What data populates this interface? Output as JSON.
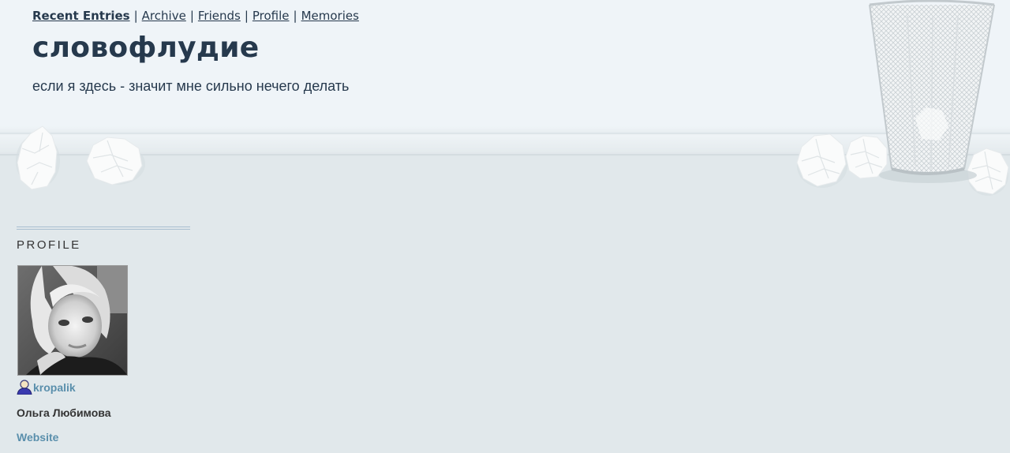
{
  "nav": {
    "items": [
      {
        "label": "Recent Entries",
        "current": true
      },
      {
        "label": "Archive"
      },
      {
        "label": "Friends"
      },
      {
        "label": "Profile"
      },
      {
        "label": "Memories"
      }
    ],
    "separator": "|"
  },
  "header": {
    "title": "словофлудие",
    "subtitle": "если я здесь - значит мне сильно нечего делать"
  },
  "sidebar": {
    "heading": "PROFILE",
    "username": "kropalik",
    "full_name": "Ольга Любимова",
    "website_label": "Website"
  },
  "icons": {
    "user": "user-icon",
    "trash": "wastebasket-icon",
    "paper": "crumpled-paper-icon"
  },
  "colors": {
    "page_bg": "#e1e8eb",
    "header_bg": "#eff4f8",
    "text_dark": "#26394d",
    "link_blue": "#5a8fac"
  }
}
